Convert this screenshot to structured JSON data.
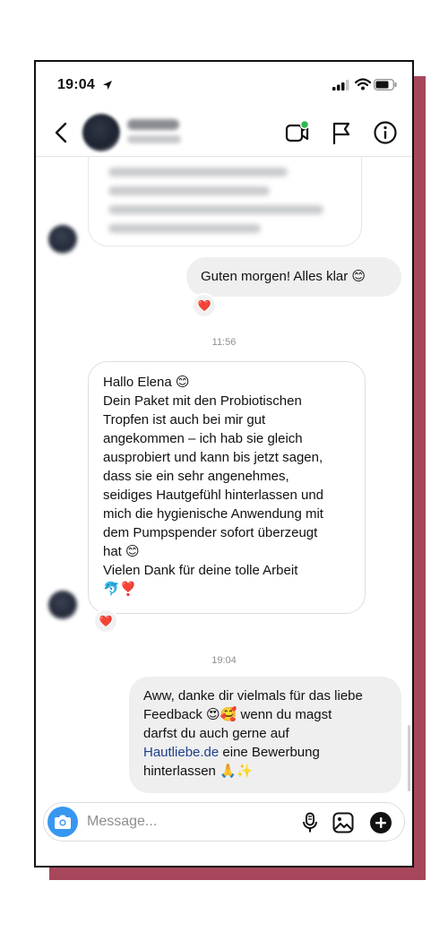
{
  "status_bar": {
    "time": "19:04"
  },
  "input": {
    "placeholder": "Message..."
  },
  "messages": {
    "out1": {
      "text": "Guten morgen! Alles klar 😊",
      "reaction": "❤️"
    },
    "timestamp1": "11:56",
    "in1": {
      "text": "Hallo Elena 😊\nDein Paket mit den Probiotischen\nTropfen ist auch bei mir gut\nangekommen – ich hab sie gleich\nausprobiert und kann bis jetzt sagen,\ndass sie ein sehr angenehmes,\nseidiges Hautgefühl hinterlassen und\nmich die hygienische Anwendung mit\ndem Pumpspender sofort überzeugt\nhat 😊\nVielen Dank für deine tolle Arbeit\n🐬❣️",
      "reaction": "❤️"
    },
    "timestamp2": "19:04",
    "out2": {
      "text_before": "Aww, danke dir vielmals für das liebe\nFeedback 😍🥰 wenn du magst\ndarfst du auch gerne auf\n",
      "link": "Hautliebe.de",
      "text_after": " eine Bewerbung\nhinterlassen 🙏✨"
    }
  },
  "colors": {
    "accent_frame": "#a7475b",
    "camera_button": "#3797f0",
    "outgoing_bubble": "#efefef",
    "link": "#1d3f8a",
    "active_dot": "#2fb84f"
  },
  "icons": [
    "location-arrow-icon",
    "signal-icon",
    "wifi-icon",
    "battery-icon",
    "chevron-left-icon",
    "video-call-icon",
    "flag-icon",
    "info-icon",
    "camera-icon",
    "microphone-icon",
    "gallery-icon",
    "plus-icon"
  ]
}
